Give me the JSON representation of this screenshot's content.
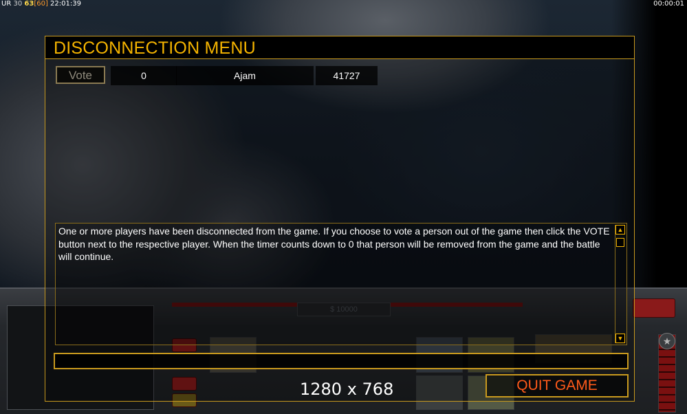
{
  "status_bar": {
    "left_ur": "UR",
    "left_n1": "30",
    "left_n2": "63",
    "left_n3": "[60]",
    "clock": "22:01:39",
    "timer": "00:00:01"
  },
  "dialog": {
    "title": "DISCONNECTION MENU",
    "player_row": {
      "vote_label": "Vote",
      "count": "0",
      "name": "Ajam",
      "ping": "41727"
    },
    "message": "One or more players have been disconnected from the game. If you choose to vote a person out of the game then click the VOTE button next to the respective player. When the timer counts down to 0 that person will be removed from the game and the battle will continue.",
    "chat_value": "",
    "quit_label": "QUIT GAME"
  },
  "hud": {
    "cash": "$ 10000"
  },
  "resolution_label": "1280 x 768",
  "colors": {
    "accent_gold": "#c99a1e",
    "title_gold": "#f5b400",
    "quit_red": "#ff5a1a"
  }
}
